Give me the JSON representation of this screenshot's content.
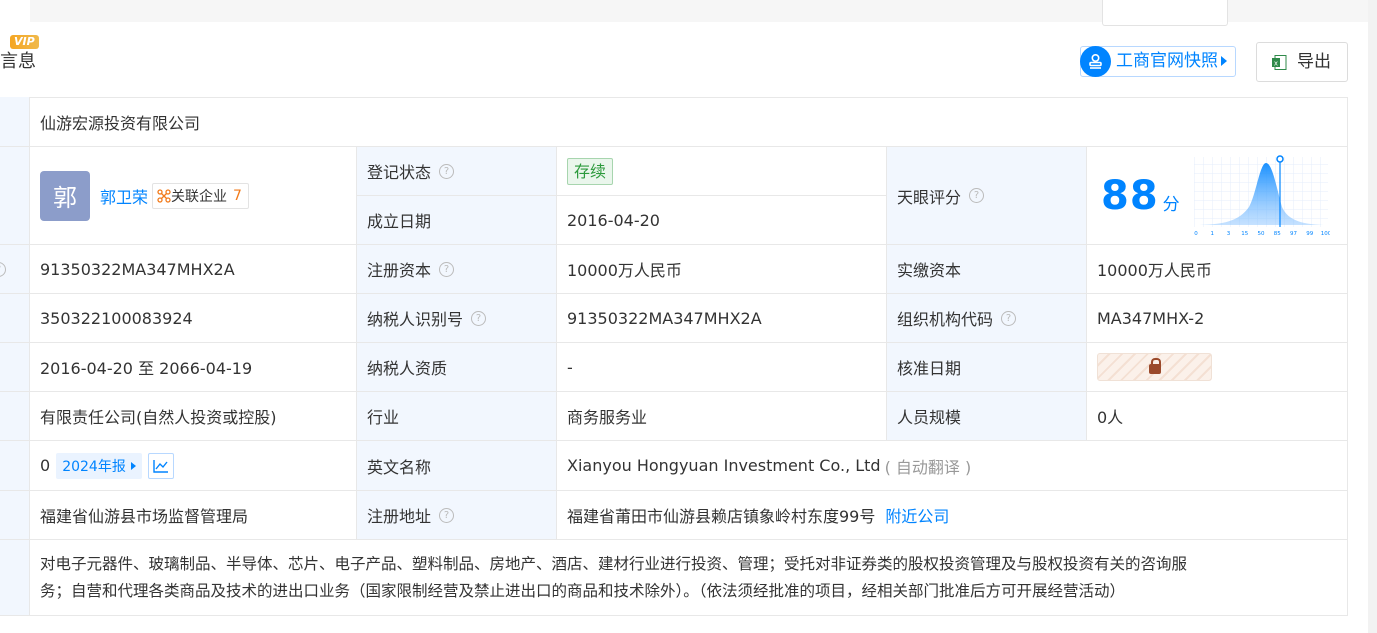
{
  "section": {
    "vip": "VIP",
    "title": "言息"
  },
  "actions": {
    "snapshot": "工商官网快照",
    "export": "导出"
  },
  "company_name": "仙游宏源投资有限公司",
  "legal_rep": {
    "avatar": "郭",
    "name": "郭卫荣",
    "related_label": "关联企业",
    "related_count": "7"
  },
  "labels": {
    "reg_status": "登记状态",
    "found_date": "成立日期",
    "tianyan_score": "天眼评分",
    "reg_capital": "注册资本",
    "paid_capital": "实缴资本",
    "taxpayer_id": "纳税人识别号",
    "org_code": "组织机构代码",
    "taxpayer_qual": "纳税人资质",
    "approval_date": "核准日期",
    "industry": "行业",
    "staff": "人员规模",
    "english_name": "英文名称",
    "reg_address": "注册地址"
  },
  "values": {
    "reg_status": "存续",
    "found_date": "2016-04-20",
    "score": "88",
    "score_unit": "分",
    "credit_code": "91350322MA347MHX2A",
    "reg_capital": "10000万人民币",
    "paid_capital": "10000万人民币",
    "reg_number": "350322100083924",
    "taxpayer_id": "91350322MA347MHX2A",
    "org_code": "MA347MHX-2",
    "business_term": "2016-04-20 至 2066-04-19",
    "taxpayer_qual": "-",
    "company_type": "有限责任公司(自然人投资或控股)",
    "industry": "商务服务业",
    "staff": "0人",
    "insured": "0",
    "annual_report": "2024年报",
    "english_name": "Xianyou Hongyuan Investment Co., Ltd",
    "auto_translate": "( 自动翻译 )",
    "authority": "福建省仙游县市场监督管理局",
    "reg_address": "福建省莆田市仙游县赖店镇象岭村东度99号",
    "nearby": "附近公司",
    "scope_line1": "对电子元器件、玻璃制品、半导体、芯片、电子产品、塑料制品、房地产、酒店、建材行业进行投资、管理；受托对非证券类的股权投资管理及与股权投资有关的咨询服",
    "scope_line2": "务；自营和代理各类商品及技术的进出口业务（国家限制经营及禁止进出口的商品和技术除外）。（依法须经批准的项目，经相关部门批准后方可开展经营活动）"
  },
  "score_axis": [
    "0",
    "1",
    "3",
    "15",
    "50",
    "85",
    "97",
    "99",
    "100"
  ],
  "colors": {
    "accent": "#0084ff",
    "label_bg": "#f2f7fe",
    "status_green": "#2c9a3c"
  }
}
